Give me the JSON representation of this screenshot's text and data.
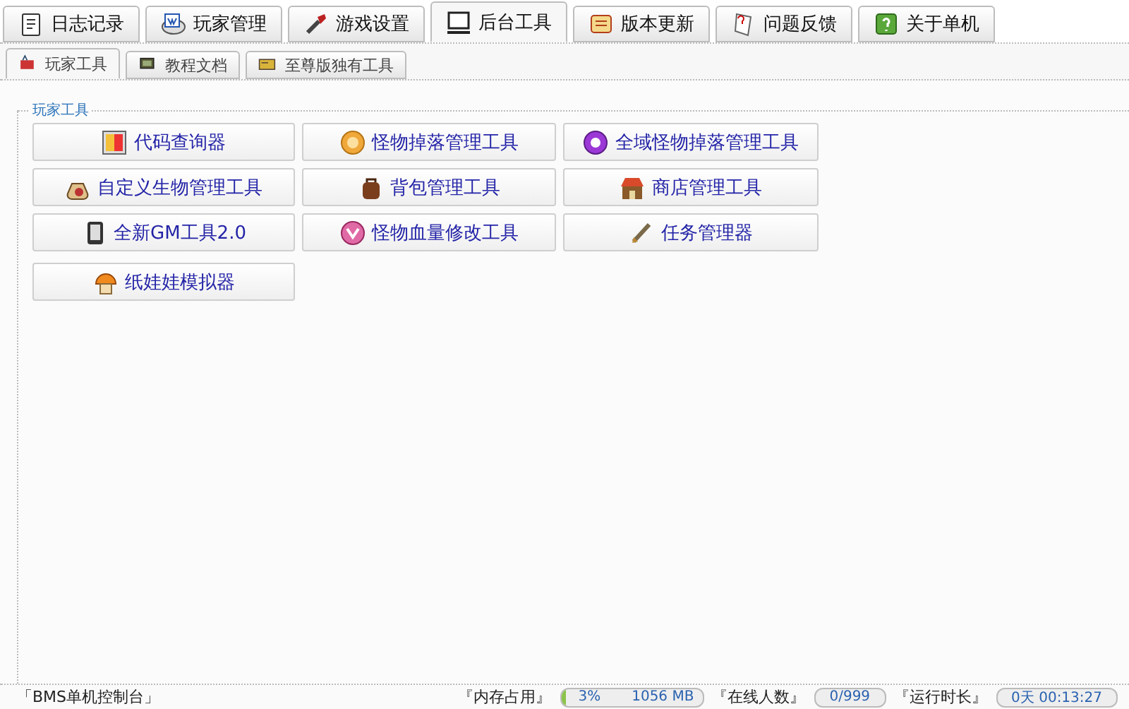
{
  "main_tabs": [
    {
      "label": "日志记录",
      "selected": false
    },
    {
      "label": "玩家管理",
      "selected": false
    },
    {
      "label": "游戏设置",
      "selected": false
    },
    {
      "label": "后台工具",
      "selected": true
    },
    {
      "label": "版本更新",
      "selected": false
    },
    {
      "label": "问题反馈",
      "selected": false
    },
    {
      "label": "关于单机",
      "selected": false
    }
  ],
  "sub_tabs": [
    {
      "label": "玩家工具",
      "selected": true
    },
    {
      "label": "教程文档",
      "selected": false
    },
    {
      "label": "至尊版独有工具",
      "selected": false
    }
  ],
  "group": {
    "title": "玩家工具",
    "buttons": [
      {
        "label": "代码查询器"
      },
      {
        "label": "怪物掉落管理工具"
      },
      {
        "label": "全域怪物掉落管理工具"
      },
      {
        "label": "自定义生物管理工具"
      },
      {
        "label": "背包管理工具"
      },
      {
        "label": "商店管理工具"
      },
      {
        "label": "全新GM工具2.0"
      },
      {
        "label": "怪物血量修改工具"
      },
      {
        "label": "任务管理器"
      },
      {
        "label": "纸娃娃模拟器"
      }
    ]
  },
  "status_bar": {
    "app_name": "「BMS单机控制台」",
    "memory_label": "『内存占用』",
    "memory": {
      "level": 0.03,
      "percent": "3%",
      "amount": "1056 MB"
    },
    "online_label": "『在线人数』",
    "online": "0/999",
    "uptime_label": "『运行时长』",
    "uptime": "0天 00:13:27"
  }
}
